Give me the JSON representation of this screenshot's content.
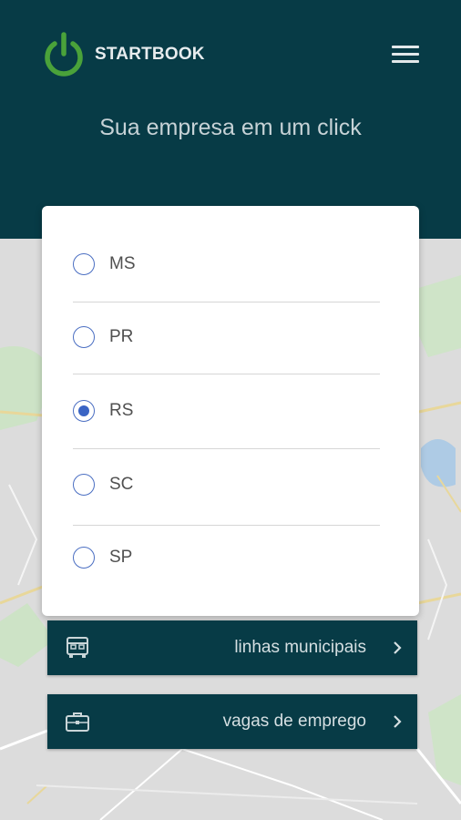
{
  "header": {
    "brand": "STARTBOOK",
    "tagline": "Sua empresa em um click"
  },
  "state_dialog": {
    "options": [
      {
        "label": "MS",
        "selected": false
      },
      {
        "label": "PR",
        "selected": false
      },
      {
        "label": "RS",
        "selected": true
      },
      {
        "label": "SC",
        "selected": false
      },
      {
        "label": "SP",
        "selected": false
      }
    ]
  },
  "actions": [
    {
      "label": "linhas municipais",
      "icon": "bus-icon"
    },
    {
      "label": "vagas de emprego",
      "icon": "briefcase-icon"
    }
  ],
  "colors": {
    "header_bg": "#073b46",
    "logo_green": "#4aa23a",
    "radio_blue": "#3a64c4"
  }
}
